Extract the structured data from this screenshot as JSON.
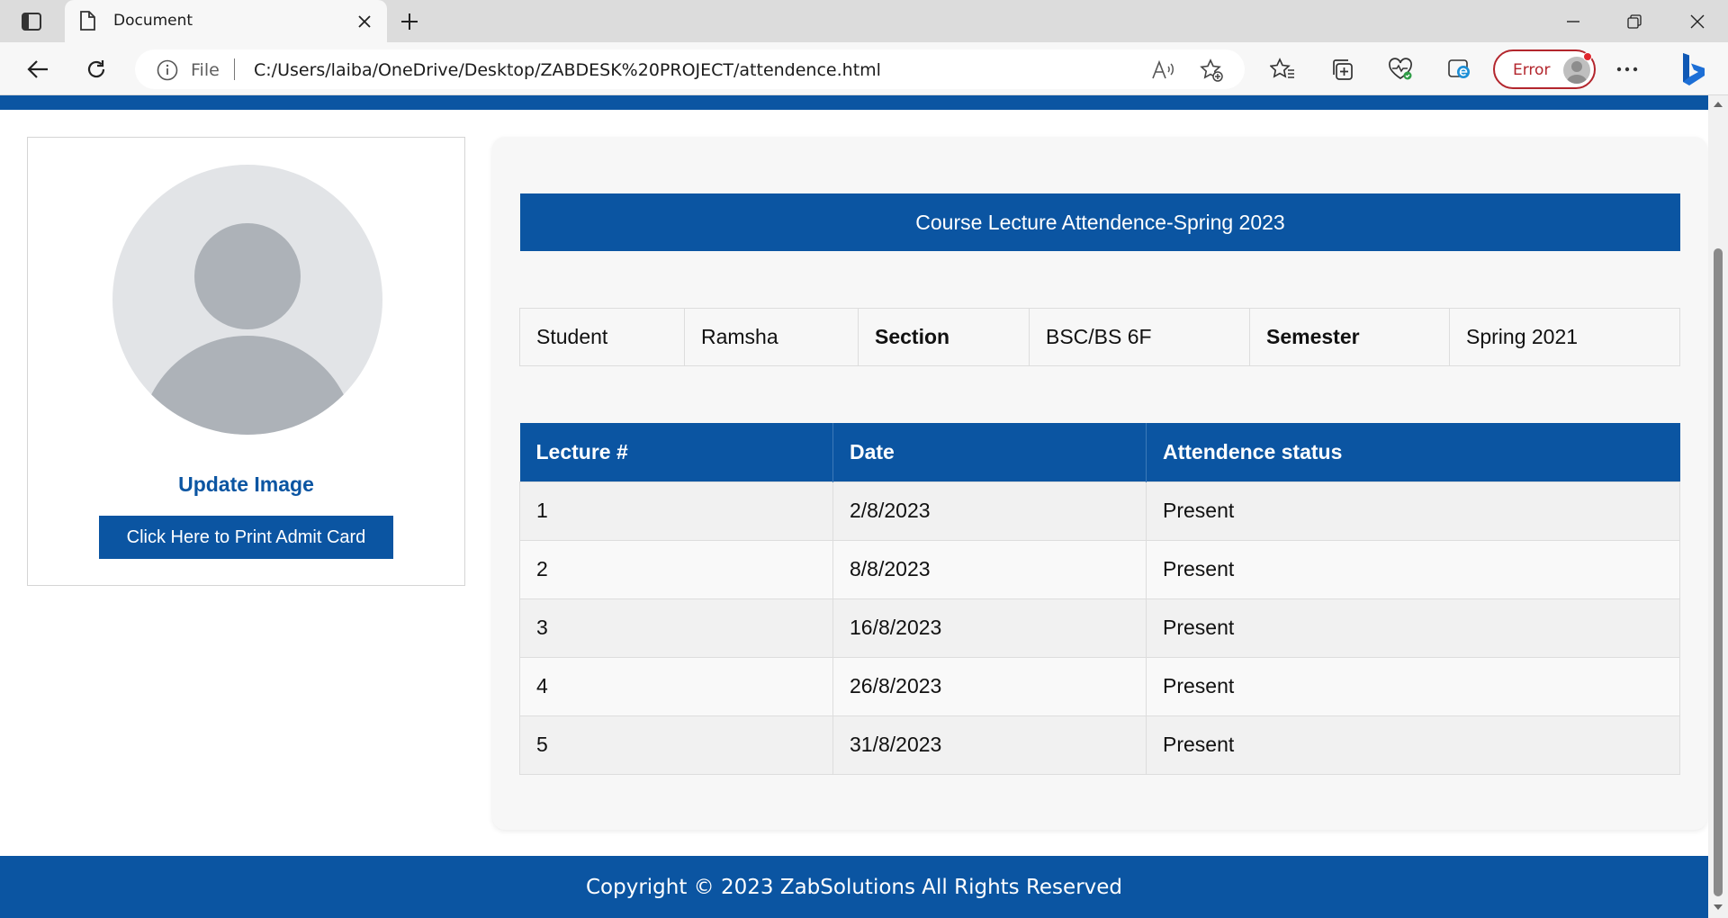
{
  "browser": {
    "tab_title": "Document",
    "address_scheme": "File",
    "url": "C:/Users/laiba/OneDrive/Desktop/ZABDESK%20PROJECT/attendence.html",
    "profile_status": "Error",
    "icons": {
      "tab_actions": "tab-actions-icon",
      "page": "document-icon",
      "close": "close-icon",
      "new_tab": "plus-icon",
      "back": "back-arrow-icon",
      "refresh": "refresh-icon",
      "info": "info-icon",
      "read_aloud": "read-aloud-icon",
      "add_favorite": "add-favorite-icon",
      "favorites": "favorites-icon",
      "collections": "collections-icon",
      "performance": "heart-pulse-icon",
      "ie_mode": "ie-mode-icon",
      "more": "more-icon",
      "copilot": "bing-copilot-icon"
    },
    "colors": {
      "error": "#b3262d"
    }
  },
  "sidebar": {
    "update_image": "Update Image",
    "print_button": "Click Here to Print Admit Card"
  },
  "main": {
    "header": "Course Lecture Attendence-Spring 2023",
    "info": {
      "student_label": "Student",
      "student_value": "Ramsha",
      "section_label": "Section",
      "section_value": "BSC/BS 6F",
      "semester_label": "Semester",
      "semester_value": "Spring 2021"
    },
    "attendance": {
      "columns": [
        "Lecture #",
        "Date",
        "Attendence status"
      ],
      "rows": [
        [
          "1",
          "2/8/2023",
          "Present"
        ],
        [
          "2",
          "8/8/2023",
          "Present"
        ],
        [
          "3",
          "16/8/2023",
          "Present"
        ],
        [
          "4",
          "26/8/2023",
          "Present"
        ],
        [
          "5",
          "31/8/2023",
          "Present"
        ]
      ]
    }
  },
  "footer": {
    "text": "Copyright © 2023 ZabSolutions All Rights Reserved"
  },
  "theme": {
    "primary": "#0b55a2"
  }
}
